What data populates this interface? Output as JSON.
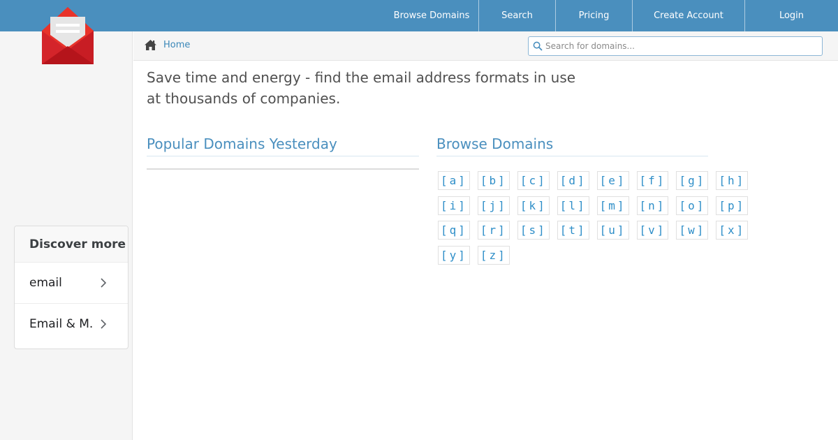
{
  "nav": {
    "items": [
      {
        "label": "Browse Domains",
        "name": "nav-browse-domains",
        "width": 134
      },
      {
        "label": "Search",
        "name": "nav-search",
        "width": 110
      },
      {
        "label": "Pricing",
        "name": "nav-pricing",
        "width": 110
      },
      {
        "label": "Create Account",
        "name": "nav-create-account",
        "width": 161
      },
      {
        "label": "Login",
        "name": "nav-login",
        "width": 134
      }
    ]
  },
  "breadcrumb": {
    "home_icon": "home-icon",
    "home_label": "Home"
  },
  "search": {
    "placeholder": "Search for domains..."
  },
  "tagline": "Save time and energy - find the email address formats in use at thousands of companies.",
  "sections": {
    "popular_title": "Popular Domains Yesterday",
    "browse_title": "Browse Domains"
  },
  "letters": [
    [
      "[a]",
      "[b]",
      "[c]",
      "[d]",
      "[e]",
      "[f]",
      "[g]",
      "[h]"
    ],
    [
      "[i]",
      "[j]",
      "[k]",
      "[l]",
      "[m]",
      "[n]",
      "[o]",
      "[p]"
    ],
    [
      "[q]",
      "[r]",
      "[s]",
      "[t]",
      "[u]",
      "[v]",
      "[w]",
      "[x]"
    ],
    [
      "[y]",
      "[z]"
    ]
  ],
  "discover": {
    "title": "Discover more",
    "items": [
      "email",
      "Email & M..."
    ]
  },
  "colors": {
    "topbar": "#4a8fbe",
    "link": "#2e8ec8",
    "logo_red": "#e8332a",
    "logo_dark_red": "#b5141b"
  }
}
